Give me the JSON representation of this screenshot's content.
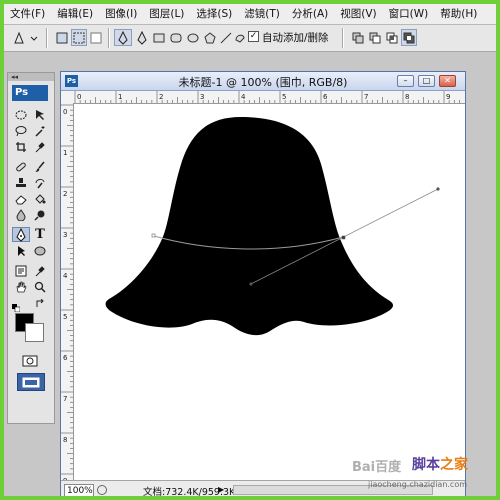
{
  "menubar": {
    "items": [
      "文件(F)",
      "编辑(E)",
      "图像(I)",
      "图层(L)",
      "选择(S)",
      "滤镜(T)",
      "分析(A)",
      "视图(V)",
      "窗口(W)",
      "帮助(H)"
    ]
  },
  "options_bar": {
    "auto_add_delete_label": "自动添加/删除",
    "auto_add_delete_checked": true
  },
  "tools": {
    "logo": "Ps",
    "type_tool_glyph": "T"
  },
  "document": {
    "title": "未标题-1 @ 100% (围巾, RGB/8)",
    "zoom": "100%",
    "doc_info": "文档:732.4K/959.3K",
    "ruler_h_labels": [
      "0",
      "1",
      "2",
      "3",
      "4",
      "5",
      "6",
      "7",
      "8",
      "9"
    ],
    "ruler_v_labels": [
      "0",
      "1",
      "2",
      "3",
      "4",
      "5",
      "6",
      "7",
      "8",
      "9"
    ]
  },
  "watermark": {
    "brand_part1": "脚本",
    "brand_part2": "之家",
    "baidu": "Bai百度",
    "site": "jiaocheng.chazidian.com"
  },
  "colors": {
    "desktop": "#6ecf3a",
    "foreground": "#000000",
    "background": "#ffffff",
    "shape": "#000000"
  }
}
